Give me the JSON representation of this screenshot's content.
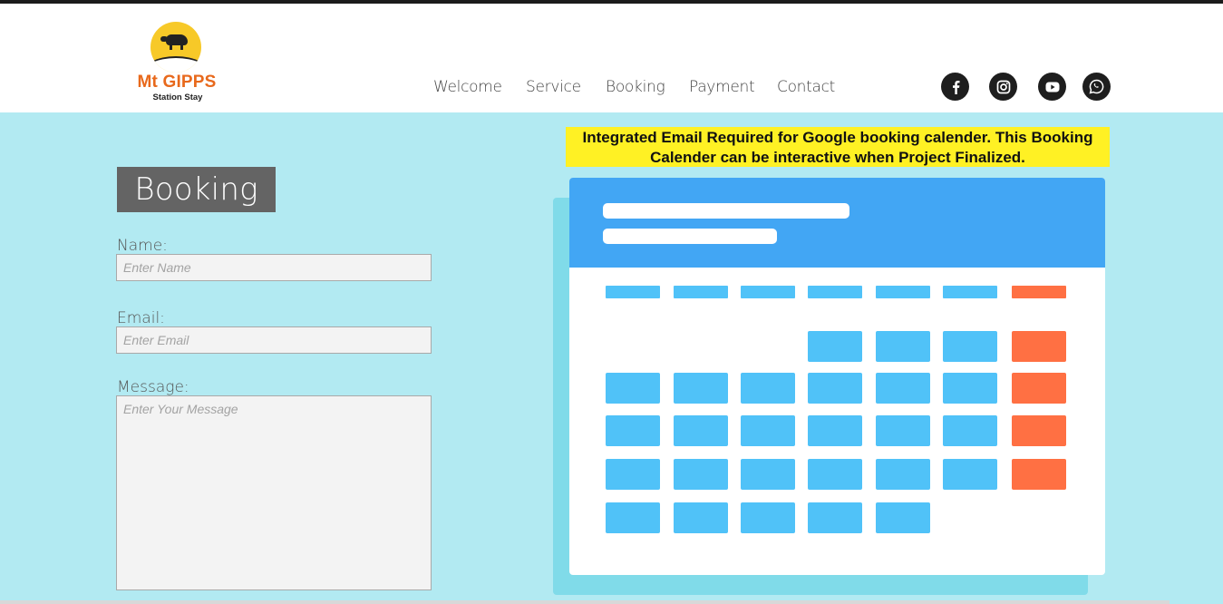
{
  "brand": {
    "name": "Mt GIPPS",
    "subtitle": "Station Stay",
    "colors": {
      "orange": "#e8691c",
      "sun": "#f7c928"
    }
  },
  "nav": {
    "items": [
      {
        "label": "Welcome"
      },
      {
        "label": "Service"
      },
      {
        "label": "Booking"
      },
      {
        "label": "Payment"
      },
      {
        "label": "Contact"
      }
    ]
  },
  "social": [
    {
      "icon": "facebook-icon"
    },
    {
      "icon": "instagram-icon"
    },
    {
      "icon": "youtube-icon"
    },
    {
      "icon": "whatsapp-icon"
    }
  ],
  "form": {
    "title": "Booking",
    "name_label": "Name:",
    "name_placeholder": "Enter Name",
    "email_label": "Email:",
    "email_placeholder": "Enter Email",
    "message_label": "Message:",
    "message_placeholder": "Enter Your Message"
  },
  "notice": {
    "text": "Integrated Email Required for Google booking calender. This Booking Calender can be interactive when Project Finalized.",
    "background": "#fff124"
  },
  "calendar": {
    "header_color": "#42a6f4",
    "cell_color": "#50c2f8",
    "weekend_color": "#ff7043",
    "rows": [
      [
        false,
        false,
        false,
        true,
        true,
        true,
        true
      ],
      [
        true,
        true,
        true,
        true,
        true,
        true,
        true
      ],
      [
        true,
        true,
        true,
        true,
        true,
        true,
        true
      ],
      [
        true,
        true,
        true,
        true,
        true,
        true,
        true
      ],
      [
        true,
        true,
        true,
        true,
        true,
        false,
        false
      ]
    ]
  },
  "theme": {
    "main_background": "#b2eaf2",
    "title_background": "#646464"
  }
}
